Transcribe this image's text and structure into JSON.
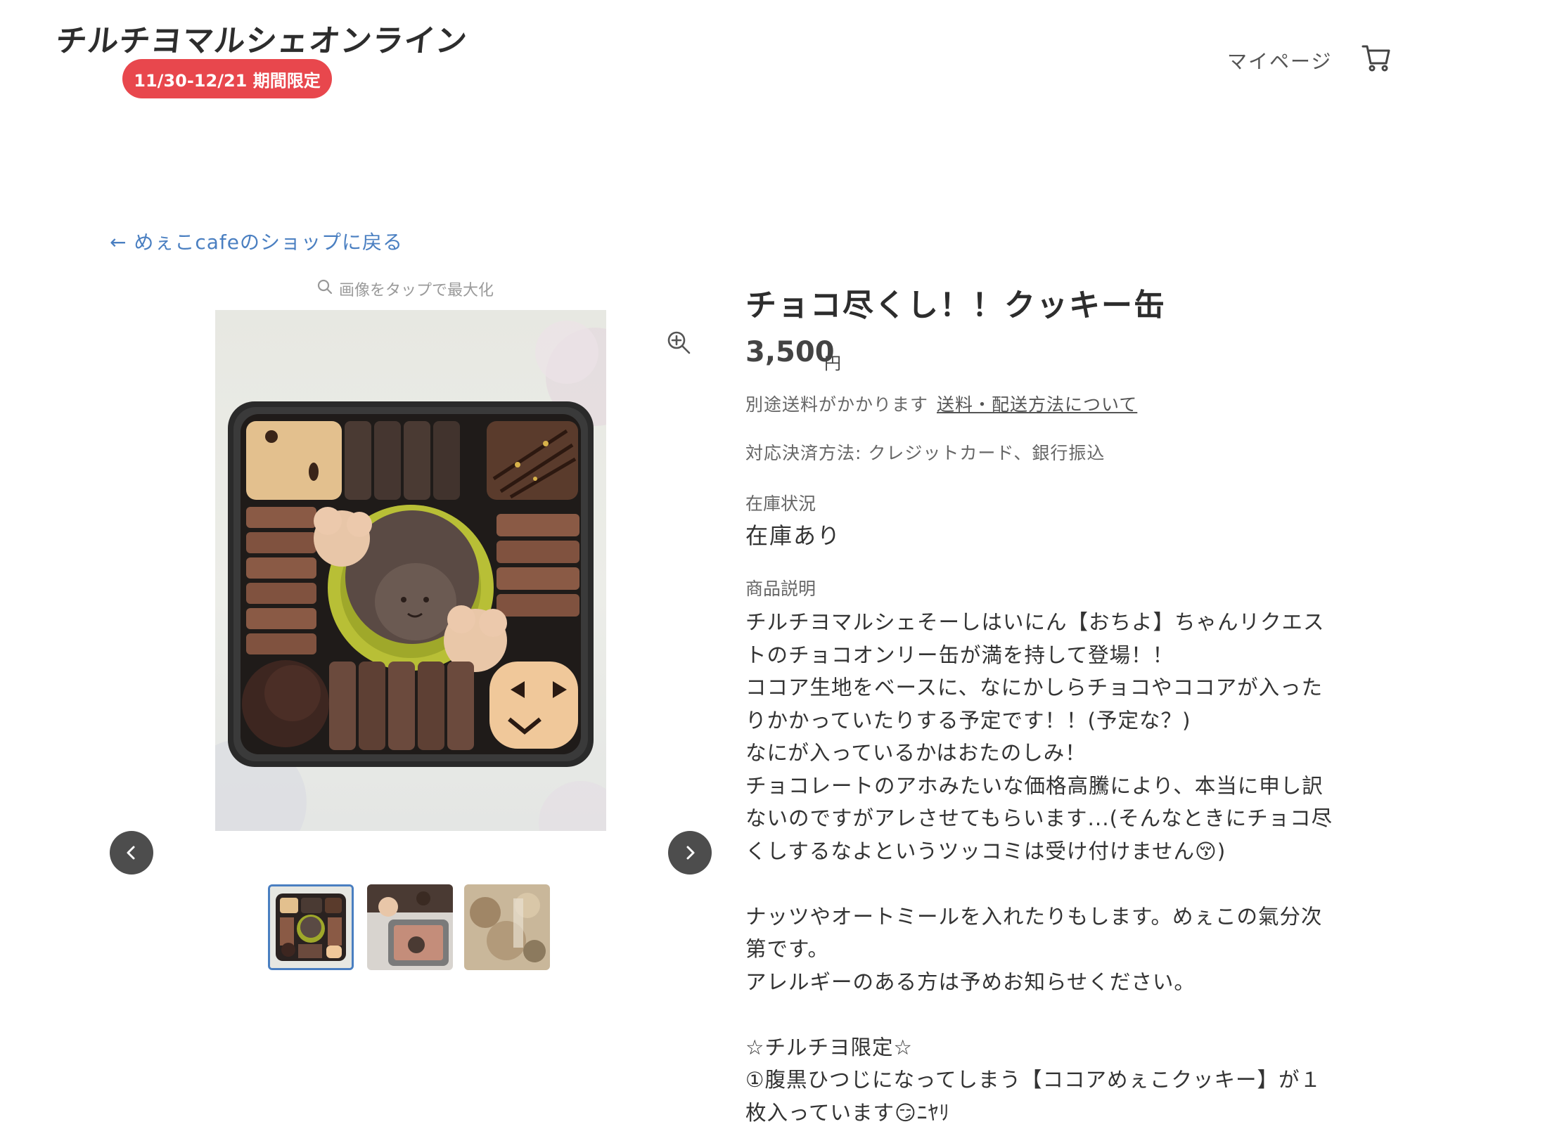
{
  "header": {
    "logo_text": "チルチヨマルシェオンライン",
    "period_badge": "11/30-12/21 期間限定",
    "mypage_label": "マイページ",
    "cart_icon": "cart-icon"
  },
  "back_link": "← めぇこcafeのショップに戻る",
  "gallery": {
    "zoom_hint": "画像をタップで最大化",
    "zoom_icon": "zoom-in-icon",
    "prev_icon": "chevron-left-icon",
    "next_icon": "chevron-right-icon",
    "thumbnail_count": 3,
    "selected_thumbnail": 1
  },
  "product": {
    "title": "チョコ尽くし！！クッキー缶",
    "price": "3,500",
    "currency": "円",
    "shipping_note": "別途送料がかかります",
    "shipping_link": "送料・配送方法について",
    "payment_methods": "対応決済方法: クレジットカード、銀行振込",
    "stock_label": "在庫状況",
    "stock_value": "在庫あり",
    "description_label": "商品説明",
    "description_lines": [
      "チルチヨマルシェそーしはいにん【おちよ】ちゃんリクエス",
      "トのチョコオンリー缶が満を持して登場！！",
      "ココア生地をベースに、なにかしらチョコやココアが入った",
      "りかかっていたりする予定です！！(予定な？)",
      "なにが入っているかはおたのしみ！",
      "チョコレートのアホみたいな価格高騰により、本当に申し訳",
      "ないのですがアレさせてもらいます...(そんなときにチョコ尽",
      "くしするなよというツッコミは受け付けません😚)",
      "",
      "ナッツやオートミールを入れたりもします。めぇこの氣分次",
      "第です。",
      "アレルギーのある方は予めお知らせください。",
      "",
      "☆チルチヨ限定☆",
      "①腹黒ひつじになってしまう【ココアめぇこクッキー】が１",
      "枚入っています😏ﾆﾔﾘ"
    ]
  },
  "colors": {
    "badge": "#e8474d",
    "link": "#4a7fc1",
    "nav_button": "#4d4d4d",
    "thumb_selected_border": "#4a7fc1"
  }
}
